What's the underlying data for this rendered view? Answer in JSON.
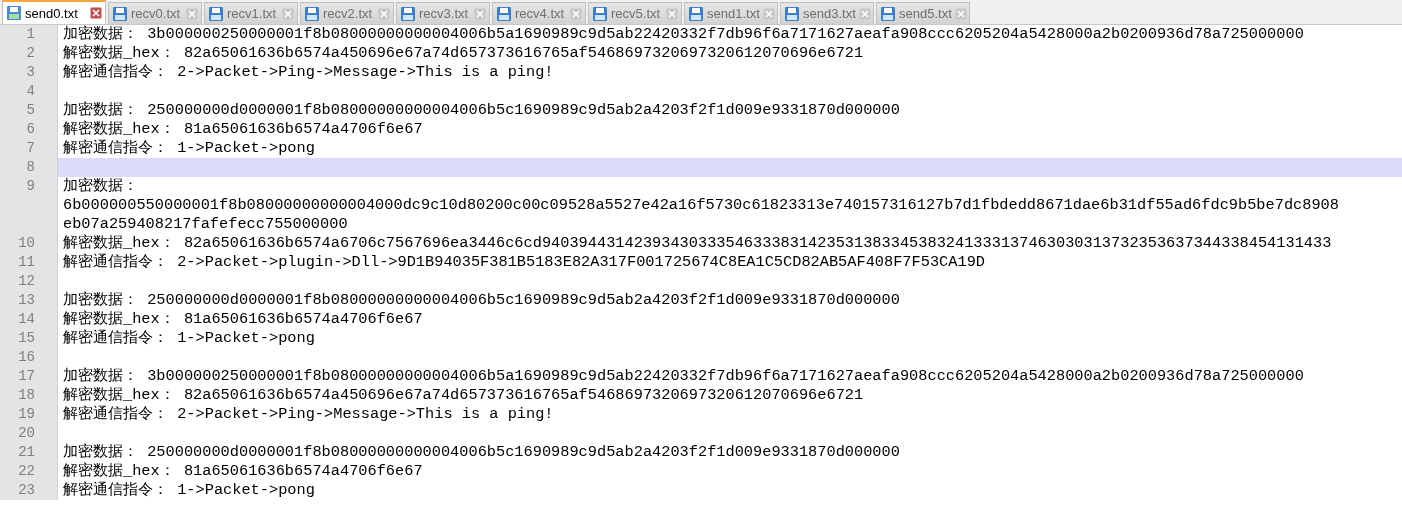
{
  "tabs": [
    {
      "label": "send0.txt",
      "selected": true
    },
    {
      "label": "recv0.txt",
      "selected": false
    },
    {
      "label": "recv1.txt",
      "selected": false
    },
    {
      "label": "recv2.txt",
      "selected": false
    },
    {
      "label": "recv3.txt",
      "selected": false
    },
    {
      "label": "recv4.txt",
      "selected": false
    },
    {
      "label": "recv5.txt",
      "selected": false
    },
    {
      "label": "send1.txt",
      "selected": false
    },
    {
      "label": "send3.txt",
      "selected": false
    },
    {
      "label": "send5.txt",
      "selected": false
    }
  ],
  "editor": {
    "lines": [
      {
        "number": "1",
        "current": false,
        "rows": [
          "加密数据： 3b000000250000001f8b08000000000004006b5a1690989c9d5ab22420332f7db96f6a7171627aeafa908ccc6205204a5428000a2b0200936d78a725000000"
        ]
      },
      {
        "number": "2",
        "current": false,
        "rows": [
          "解密数据_hex： 82a65061636b6574a450696e67a74d657373616765af5468697320697320612070696e6721"
        ]
      },
      {
        "number": "3",
        "current": false,
        "rows": [
          "解密通信指令： 2->Packet->Ping->Message->This is a ping!"
        ]
      },
      {
        "number": "4",
        "current": false
      },
      {
        "number": "5",
        "current": false,
        "rows": [
          "加密数据： 250000000d0000001f8b08000000000004006b5c1690989c9d5ab2a4203f2f1d009e9331870d000000"
        ]
      },
      {
        "number": "6",
        "current": false,
        "rows": [
          "解密数据_hex： 81a65061636b6574a4706f6e67"
        ]
      },
      {
        "number": "7",
        "current": false,
        "rows": [
          "解密通信指令： 1->Packet->pong"
        ]
      },
      {
        "number": "8",
        "current": true
      },
      {
        "number": "9",
        "current": false,
        "rows": [
          "加密数据：",
          "6b000000550000001f8b08000000000004000dc9c10d80200c00c09528a5527e42a16f5730c61823313e740157316127b7d1fbdedd8671dae6b31df55ad6fdc9b5be7dc8908",
          "eb07a259408217fafefecc755000000"
        ]
      },
      {
        "number": "10",
        "current": false,
        "rows": [
          "解密数据_hex： 82a65061636b6574a6706c7567696ea3446c6cd94039443142393430333546333831423531383345383241333137463030313732353637344338454131433"
        ]
      },
      {
        "number": "11",
        "current": false,
        "rows": [
          "解密通信指令： 2->Packet->plugin->Dll->9D1B94035F381B5183E82A317F001725674C8EA1C5CD82AB5AF408F7F53CA19D"
        ]
      },
      {
        "number": "12",
        "current": false
      },
      {
        "number": "13",
        "current": false,
        "rows": [
          "加密数据： 250000000d0000001f8b08000000000004006b5c1690989c9d5ab2a4203f2f1d009e9331870d000000"
        ]
      },
      {
        "number": "14",
        "current": false,
        "rows": [
          "解密数据_hex： 81a65061636b6574a4706f6e67"
        ]
      },
      {
        "number": "15",
        "current": false,
        "rows": [
          "解密通信指令： 1->Packet->pong"
        ]
      },
      {
        "number": "16",
        "current": false
      },
      {
        "number": "17",
        "current": false,
        "rows": [
          "加密数据： 3b000000250000001f8b08000000000004006b5a1690989c9d5ab22420332f7db96f6a7171627aeafa908ccc6205204a5428000a2b0200936d78a725000000"
        ]
      },
      {
        "number": "18",
        "current": false,
        "rows": [
          "解密数据_hex： 82a65061636b6574a450696e67a74d657373616765af5468697320697320612070696e6721"
        ]
      },
      {
        "number": "19",
        "current": false,
        "rows": [
          "解密通信指令： 2->Packet->Ping->Message->This is a ping!"
        ]
      },
      {
        "number": "20",
        "current": false
      },
      {
        "number": "21",
        "current": false,
        "rows": [
          "加密数据： 250000000d0000001f8b08000000000004006b5c1690989c9d5ab2a4203f2f1d009e9331870d000000"
        ]
      },
      {
        "number": "22",
        "current": false,
        "rows": [
          "解密数据_hex： 81a65061636b6574a4706f6e67"
        ]
      },
      {
        "number": "23",
        "current": false,
        "rows": [
          "解密通信指令： 1->Packet->pong"
        ]
      }
    ]
  }
}
